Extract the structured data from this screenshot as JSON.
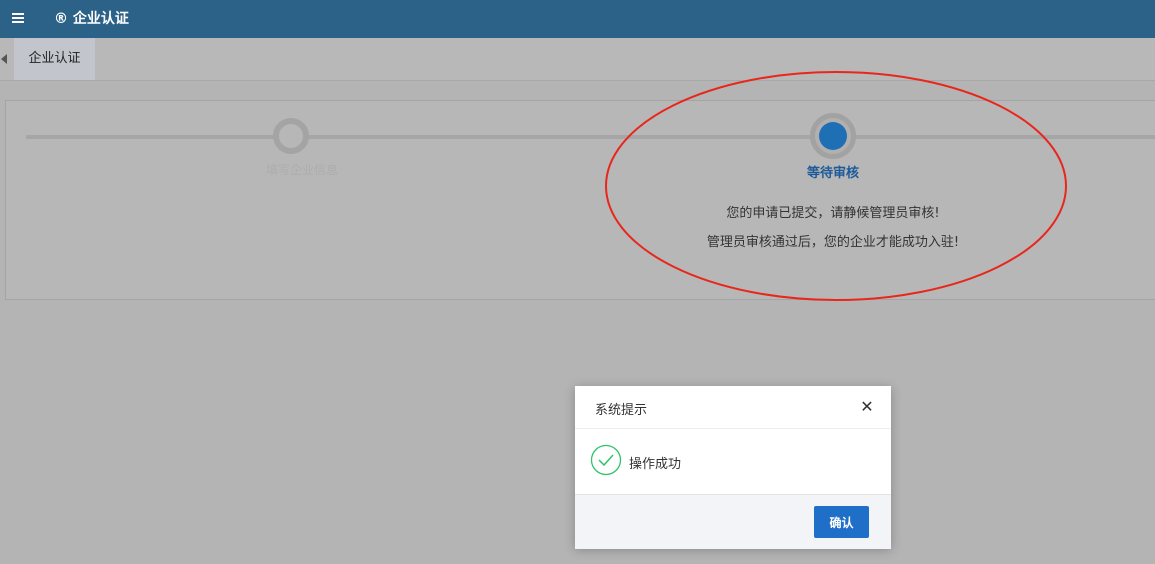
{
  "header": {
    "title": "® 企业认证",
    "menu_icon": "hamburger-menu-icon",
    "bg_color": "#2c6288"
  },
  "tabs": {
    "active_label": "企业认证",
    "left_arrow_icon": "caret-left-icon"
  },
  "steps": [
    {
      "label": "填写企业信息",
      "state": "done"
    },
    {
      "label": "等待审核",
      "state": "current",
      "color": "#1f6fb5"
    }
  ],
  "messages": {
    "line1": "您的申请已提交，请静候管理员审核!",
    "line2": "管理员审核通过后，您的企业才能成功入驻!"
  },
  "annotation": {
    "shape": "ellipse",
    "color": "#e8261c"
  },
  "dialog": {
    "title": "系统提示",
    "close_icon": "close-x-icon",
    "message": "操作成功",
    "status_icon": "check-circle-icon",
    "status_color": "#2ec46a",
    "confirm_label": "确认",
    "confirm_color": "#1f6fc9"
  }
}
